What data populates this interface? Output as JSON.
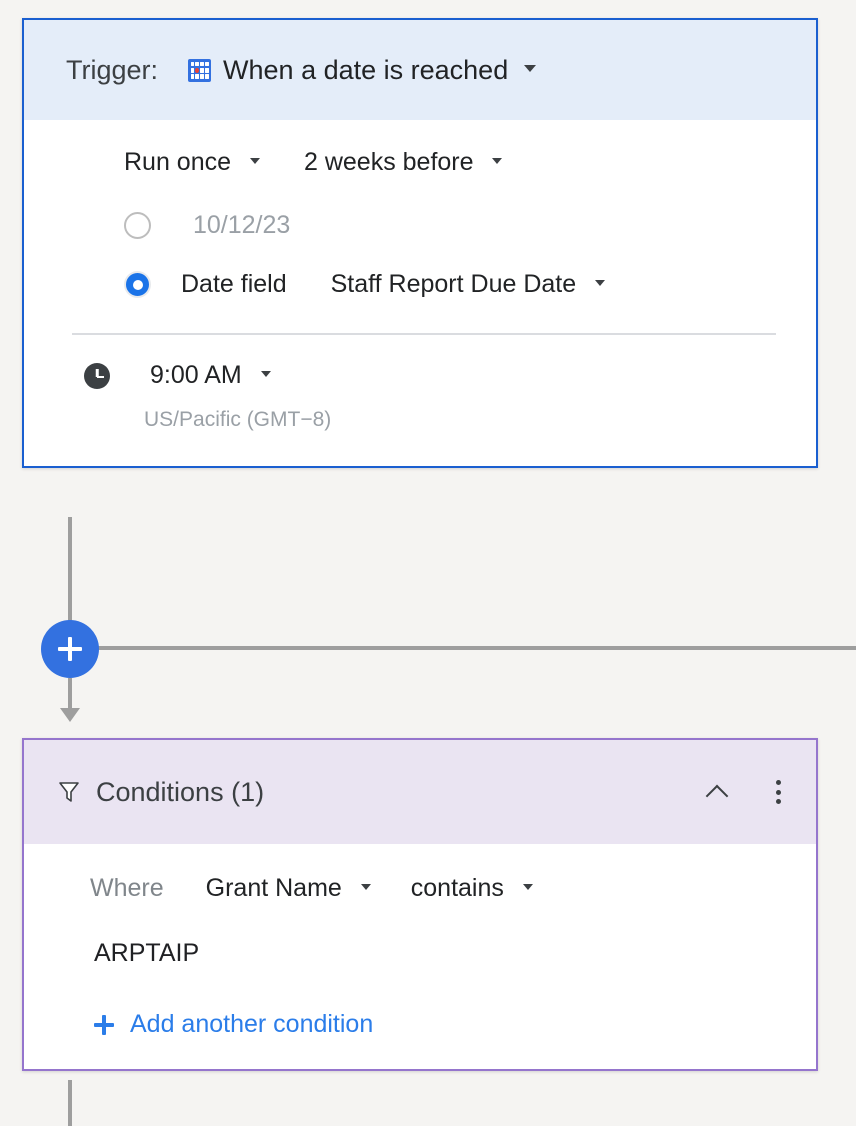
{
  "canvas": {
    "background_color": "#f5f4f2"
  },
  "trigger": {
    "border_color": "#1a5fd0",
    "header_bg": "#e4edf9",
    "label": "Trigger:",
    "icon": "calendar-icon",
    "title": "When a date is reached",
    "schedule": {
      "frequency": "Run once",
      "offset": "2 weeks before"
    },
    "date_option": {
      "selected": false,
      "value": "10/12/23"
    },
    "date_field_option": {
      "selected": true,
      "label": "Date field",
      "value": "Staff Report Due Date"
    },
    "time": {
      "icon": "clock-icon",
      "value": "9:00 AM",
      "timezone": "US/Pacific (GMT−8)"
    }
  },
  "add_node": {
    "icon": "plus-icon",
    "color": "#3371e0"
  },
  "conditions": {
    "border_color": "#9575cd",
    "header_bg": "#eae4f2",
    "icon": "filter-icon",
    "title": "Conditions (1)",
    "collapse_icon": "chevron-up-icon",
    "menu_icon": "more-vert-icon",
    "where_label": "Where",
    "field": "Grant Name",
    "operator": "contains",
    "value": "ARPTAIP",
    "add_link": {
      "icon": "plus-icon",
      "label": "Add another condition",
      "color": "#2b7de9"
    }
  }
}
